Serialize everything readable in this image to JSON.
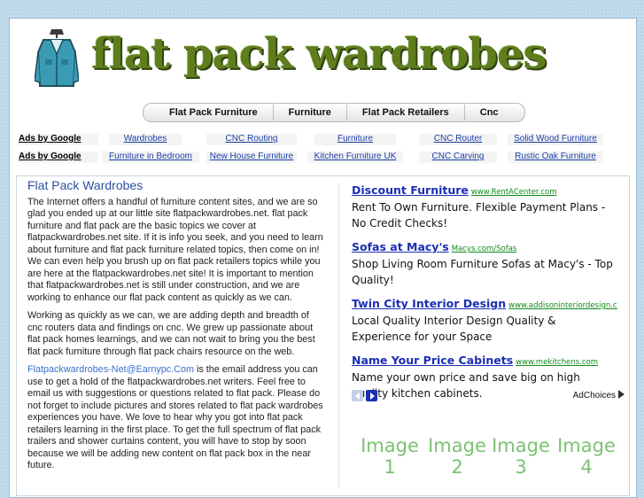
{
  "site": {
    "title": "flat pack wardrobes"
  },
  "nav": [
    "Flat Pack Furniture",
    "Furniture",
    "Flat Pack Retailers",
    "Cnc"
  ],
  "ad_rows": [
    {
      "label": "Ads by Google",
      "links": [
        "Wardrobes",
        "CNC Routing",
        "Furniture",
        "CNC Router",
        "Solid Wood Furniture"
      ]
    },
    {
      "label": "Ads by Google",
      "links": [
        "Furniture in Bedroom",
        "New House Furniture",
        "Kitchen Furniture UK",
        "CNC Carving",
        "Rustic Oak Furniture"
      ]
    }
  ],
  "article": {
    "heading": "Flat Pack Wardrobes",
    "p1": "The Internet offers a handful of furniture content sites, and we are so glad you ended up at our little site flatpackwardrobes.net. flat pack furniture and flat pack are the basic topics we cover at flatpackwardrobes.net site. If it is info you seek, and you need to learn about furniture and flat pack furniture related topics, then come on in! We can even help you brush up on flat pack retailers topics while you are here at the flatpackwardrobes.net site! It is important to mention that flatpackwardrobes.net is still under construction, and we are working to enhance our flat pack content as quickly as we can.",
    "p2": "Working as quickly as we can, we are adding depth and breadth of cnc routers data and findings on cnc. We grew up passionate about flat pack homes learnings, and we can not wait to bring you the best flat pack furniture through flat pack chairs resource on the web.",
    "email": "Flatpackwardrobes-Net@Earnypc.Com",
    "p3": " is the email address you can use to get a hold of the flatpackwardrobes.net writers. Feel free to email us with suggestions or questions related to flat pack. Please do not forget to include pictures and stores related to flat pack wardrobes experiences you have. We love to hear why you got into flat pack retailers learning in the first place. To get the full spectrum of flat pack trailers and shower curtains content, you will have to stop by soon because we will be adding new content on flat pack box in the near future."
  },
  "ads": [
    {
      "title": "Discount Furniture",
      "url": "www.RentACenter.com",
      "text": "Rent To Own Furniture. Flexible Payment Plans - No Credit Checks!"
    },
    {
      "title": "Sofas at Macy's",
      "url": "Macys.com/Sofas",
      "text": "Shop Living Room Furniture Sofas at Macy's - Top Quality!"
    },
    {
      "title": "Twin City Interior Design",
      "url": "www.addisoninteriordesign.com/m",
      "text": "Local Quality Interior Design Quality & Experience for your Space"
    },
    {
      "title": "Name Your Price Cabinets",
      "url": "www.mekitchens.com",
      "text": "Name your own price and save big on high quality kitchen cabinets."
    }
  ],
  "adchoices": "AdChoices",
  "images": [
    "Image 1",
    "Image 2",
    "Image 3",
    "Image 4"
  ],
  "icons": {
    "logo": "wardrobe-suit-icon",
    "ad_prev": "arrow-left-icon",
    "ad_next": "arrow-right-icon",
    "adchoices": "adchoices-triangle-icon"
  },
  "colors": {
    "title_green": "#5f7d1c",
    "link_blue": "#1b2fb4",
    "url_green": "#128a1c",
    "image_green": "#7cc273",
    "background": "#bcd7ea"
  }
}
